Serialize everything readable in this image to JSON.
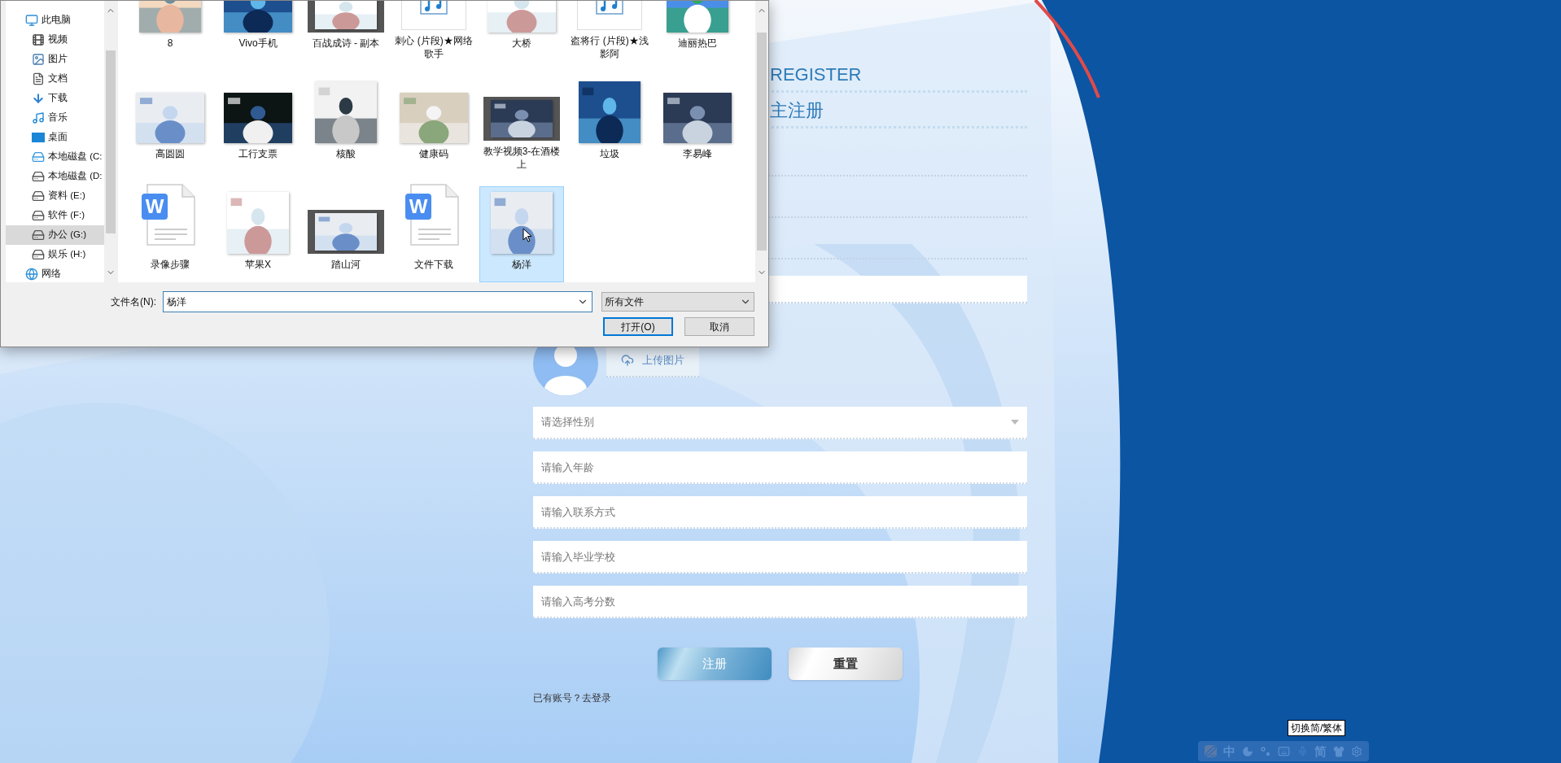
{
  "file_dialog": {
    "nav": [
      {
        "label": "此电脑",
        "kind": "computer",
        "selected": false,
        "children": [
          {
            "label": "视频",
            "kind": "video",
            "selected": false
          },
          {
            "label": "图片",
            "kind": "picture",
            "selected": false
          },
          {
            "label": "文档",
            "kind": "document",
            "selected": false
          },
          {
            "label": "下载",
            "kind": "download",
            "selected": false
          },
          {
            "label": "音乐",
            "kind": "music",
            "selected": false
          },
          {
            "label": "桌面",
            "kind": "desktop",
            "selected": false
          },
          {
            "label": "本地磁盘 (C:",
            "kind": "system-drive",
            "selected": false
          },
          {
            "label": "本地磁盘 (D:",
            "kind": "drive",
            "selected": false
          },
          {
            "label": "资料 (E:)",
            "kind": "drive",
            "selected": false
          },
          {
            "label": "软件 (F:)",
            "kind": "drive",
            "selected": false
          },
          {
            "label": "办公 (G:)",
            "kind": "drive",
            "selected": true
          },
          {
            "label": "娱乐 (H:)",
            "kind": "drive",
            "selected": false
          }
        ]
      },
      {
        "label": "网络",
        "kind": "network",
        "selected": false
      }
    ],
    "files": [
      {
        "name": "8",
        "selected": false
      },
      {
        "name": "Vivo手机",
        "selected": false
      },
      {
        "name": "百战成诗 - 副本",
        "kind": "video",
        "selected": false
      },
      {
        "name": "刺心 (片段)★网络歌手",
        "kind": "audio",
        "selected": false
      },
      {
        "name": "大桥",
        "selected": false
      },
      {
        "name": "盗将行 (片段)★浅影阿",
        "kind": "audio",
        "selected": false
      },
      {
        "name": "迪丽热巴",
        "selected": false
      },
      {
        "name": "高圆圆",
        "selected": false
      },
      {
        "name": "工行支票",
        "selected": false
      },
      {
        "name": "核酸",
        "selected": false
      },
      {
        "name": "健康码",
        "selected": false
      },
      {
        "name": "教学视频3-在酒楼上",
        "kind": "video",
        "selected": false
      },
      {
        "name": "垃圾",
        "selected": false
      },
      {
        "name": "李易峰",
        "selected": false
      },
      {
        "name": "录像步骤",
        "kind": "word",
        "badge": "W",
        "selected": false
      },
      {
        "name": "苹果X",
        "selected": false
      },
      {
        "name": "踏山河",
        "kind": "video",
        "selected": false
      },
      {
        "name": "文件下载",
        "kind": "word",
        "badge": "W",
        "selected": false
      },
      {
        "name": "杨洋",
        "selected": true
      }
    ],
    "file_name_label": "文件名(N):",
    "file_name": "杨洋",
    "file_type": "所有文件",
    "buttons": [
      {
        "label": "打开(O)",
        "default": true
      },
      {
        "label": "取消",
        "default": false
      }
    ]
  },
  "register": {
    "title_en": "REGISTER",
    "title": "主注册",
    "upload_label": "上传图片",
    "gender_placeholder": "请选择性别",
    "fields": [
      {
        "placeholder": "请输入年龄"
      },
      {
        "placeholder": "请输入联系方式"
      },
      {
        "placeholder": "请输入毕业学校"
      },
      {
        "placeholder": "请输入高考分数"
      }
    ],
    "buttons": [
      {
        "label": "注册",
        "kind": "primary"
      },
      {
        "label": "重置",
        "kind": "secondary"
      }
    ],
    "login_prompt": "已有账号？",
    "login_link": "去登录"
  },
  "tooltip": "切换简/繁体",
  "ime_toolbar": {
    "mode_label": "中",
    "script_label": "简"
  }
}
